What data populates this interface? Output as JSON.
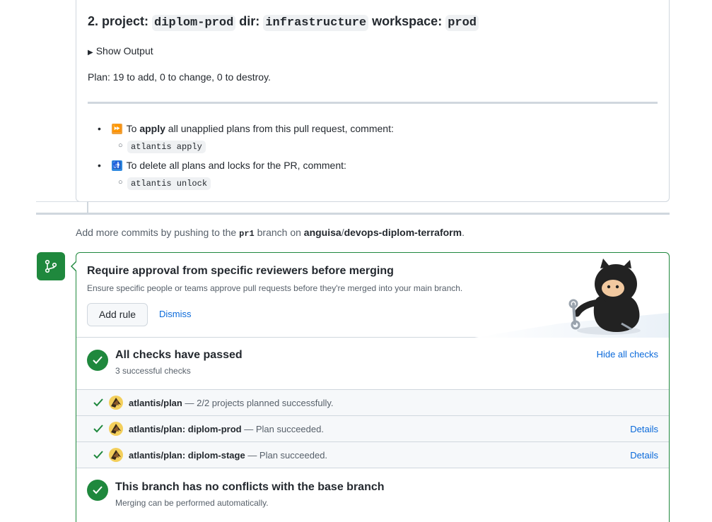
{
  "plan_comment": {
    "heading_prefix": "2. project:",
    "project": "diplom-prod",
    "dir_label": "dir:",
    "dir": "infrastructure",
    "workspace_label": "workspace:",
    "workspace": "prod",
    "show_output": "Show Output",
    "plan_summary": "Plan: 19 to add, 0 to change, 0 to destroy.",
    "tip_apply_pre": "To",
    "tip_apply_bold": "apply",
    "tip_apply_post": "all unapplied plans from this pull request, comment:",
    "tip_apply_cmd": "atlantis apply",
    "tip_unlock_text": "To delete all plans and locks for the PR, comment:",
    "tip_unlock_cmd": "atlantis unlock"
  },
  "push_note": {
    "pre": "Add more commits by pushing to the",
    "branch": "pr1",
    "mid": "branch on",
    "owner": "anguisa",
    "slash": "/",
    "repo": "devops-diplom-terraform",
    "end": "."
  },
  "promo": {
    "title": "Require approval from specific reviewers before merging",
    "description": "Ensure specific people or teams approve pull requests before they're merged into your main branch.",
    "add_rule": "Add rule",
    "dismiss": "Dismiss"
  },
  "checks": {
    "title": "All checks have passed",
    "subtitle": "3 successful checks",
    "hide_link": "Hide all checks",
    "items": [
      {
        "name": "atlantis/plan",
        "desc": "— 2/2 projects planned successfully.",
        "details": ""
      },
      {
        "name": "atlantis/plan: diplom-prod",
        "desc": "— Plan succeeded.",
        "details": "Details"
      },
      {
        "name": "atlantis/plan: diplom-stage",
        "desc": "— Plan succeeded.",
        "details": "Details"
      }
    ]
  },
  "conflicts": {
    "title": "This branch has no conflicts with the base branch",
    "subtitle": "Merging can be performed automatically."
  },
  "colors": {
    "success": "#1f883d",
    "link": "#0969da",
    "muted": "#57606a"
  }
}
